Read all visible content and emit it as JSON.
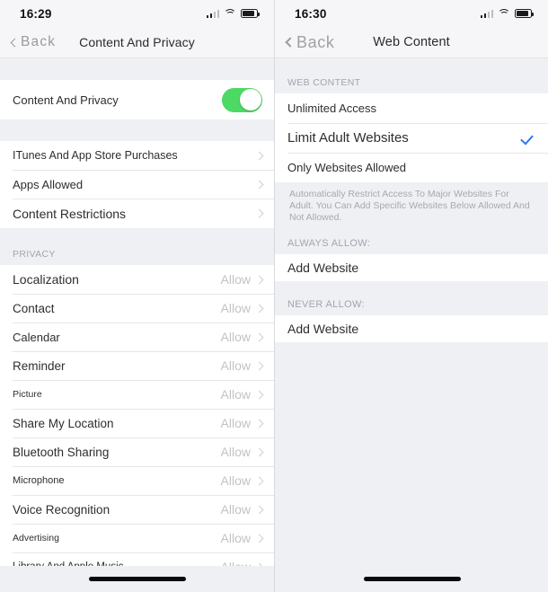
{
  "left": {
    "status": {
      "time": "16:29",
      "signal_icon": "cellular-signal-icon",
      "wifi_icon": "wifi-icon",
      "battery_icon": "battery-icon"
    },
    "nav": {
      "back_label": "Back",
      "title": "Content And Privacy"
    },
    "toggle_row": {
      "label": "Content And Privacy",
      "state": "on",
      "color": "#4cd964"
    },
    "menu_items": [
      {
        "label": "ITunes And App Store Purchases"
      },
      {
        "label": "Apps Allowed"
      },
      {
        "label": "Content Restrictions"
      }
    ],
    "privacy_header": "PRIVACY",
    "privacy_items": [
      {
        "label": "Localization",
        "value": "Allow"
      },
      {
        "label": "Contact",
        "value": "Allow"
      },
      {
        "label": "Calendar",
        "value": "Allow"
      },
      {
        "label": "Reminder",
        "value": "Allow"
      },
      {
        "label": "Picture",
        "value": "Allow"
      },
      {
        "label": "Share My Location",
        "value": "Allow"
      },
      {
        "label": "Bluetooth Sharing",
        "value": "Allow"
      },
      {
        "label": "Microphone",
        "value": "Allow"
      },
      {
        "label": "Voice Recognition",
        "value": "Allow"
      },
      {
        "label": "Advertising",
        "value": "Allow"
      },
      {
        "label": "Library And Apple Music",
        "value": "Allow"
      }
    ]
  },
  "right": {
    "status": {
      "time": "16:30",
      "signal_icon": "cellular-signal-icon",
      "wifi_icon": "wifi-icon",
      "battery_icon": "battery-icon"
    },
    "nav": {
      "back_label": "Back",
      "title": "Web Content"
    },
    "web_content_header": "WEB CONTENT",
    "options": [
      {
        "label": "Unlimited Access",
        "selected": false
      },
      {
        "label": "Limit Adult Websites",
        "selected": true
      },
      {
        "label": "Only Websites Allowed",
        "selected": false
      }
    ],
    "footnote": "Automatically Restrict Access To Major Websites For Adult. You Can Add Specific Websites Below Allowed And Not Allowed.",
    "always_allow_header": "ALWAYS ALLOW:",
    "always_allow_action": "Add Website",
    "never_allow_header": "NEVER ALLOW:",
    "never_allow_action": "Add Website",
    "check_color": "#3478f6"
  }
}
